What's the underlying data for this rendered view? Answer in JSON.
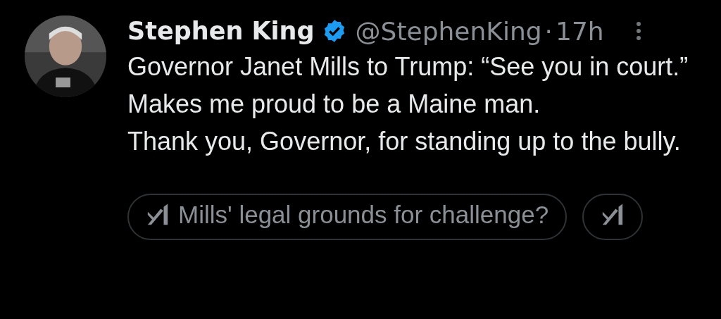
{
  "post": {
    "author": "Stephen King",
    "verified": true,
    "handle": "@StephenKing",
    "separator": "·",
    "time": "17h",
    "lines": [
      "Governor Janet Mills to Trump: “See you in court.”",
      "Makes me proud to be a Maine man.",
      "Thank you, Governor, for standing up to the bully."
    ]
  },
  "suggestions": [
    {
      "label": "Mills' legal grounds for challenge?"
    },
    {
      "kind": "icon_only"
    }
  ]
}
